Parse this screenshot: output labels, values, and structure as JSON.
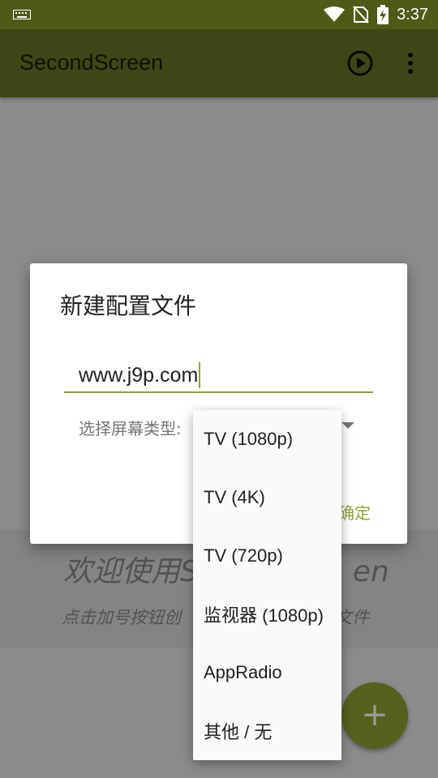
{
  "status_bar": {
    "time": "3:37",
    "icons": [
      "keyboard-icon",
      "wifi-icon",
      "no-sim-icon",
      "battery-charging-icon"
    ]
  },
  "app_bar": {
    "title": "SecondScreen",
    "actions": [
      "play-circle-icon",
      "more-vert-icon"
    ]
  },
  "background": {
    "welcome_title_prefix": "欢迎使用S",
    "welcome_title_suffix": "en",
    "welcome_sub_prefix": "点击加号按钮创",
    "welcome_sub_suffix": "文件",
    "fab_label": "+"
  },
  "dialog": {
    "title": "新建配置文件",
    "name_value": "www.j9p.com",
    "select_label": "选择屏幕类型:",
    "ok_label": "确定"
  },
  "dropdown": {
    "options": [
      "TV (1080p)",
      "TV (4K)",
      "TV (720p)",
      "监视器 (1080p)",
      "AppRadio",
      "其他 / 无"
    ]
  },
  "colors": {
    "status_bar": "#4f5a17",
    "app_bar": "#687624",
    "accent": "#8fa232"
  }
}
